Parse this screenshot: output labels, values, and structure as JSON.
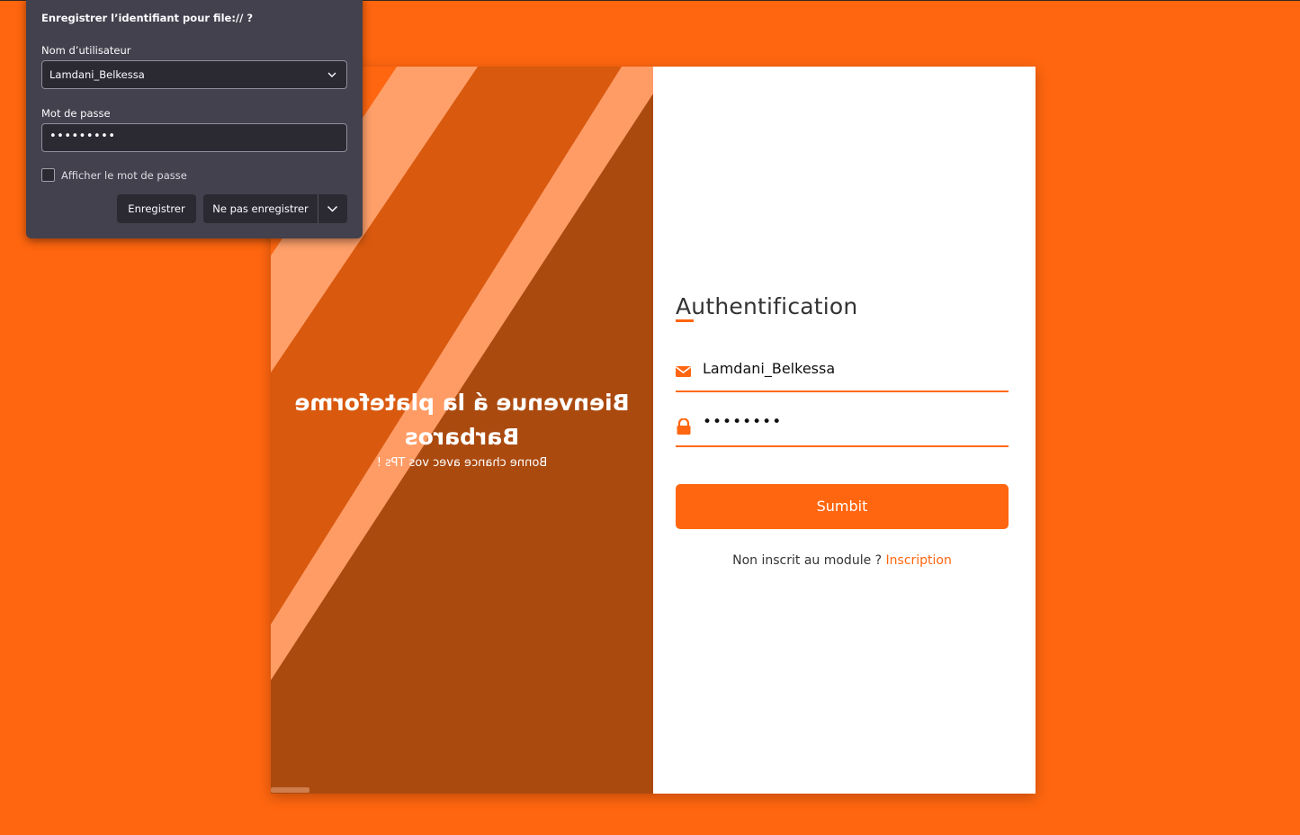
{
  "page": {
    "background": "#ff660f",
    "accent": "#ff660f"
  },
  "welcome": {
    "heading_line1": "Bienvenue á la plateforme",
    "heading_line2": "Barbaros",
    "subtitle": "Bonne chance avec vos TPs !"
  },
  "auth": {
    "title": "Authentification",
    "username_icon": "envelope-icon",
    "username_value": "Lamdani_Belkessa",
    "password_icon": "lock-icon",
    "password_value": "••••••••",
    "submit_label": "Sumbit",
    "signup_prompt": "Non inscrit au module ?",
    "signup_link": "Inscription"
  },
  "save_popup": {
    "title": "Enregistrer l’identifiant pour file:// ?",
    "username_label": "Nom d’utilisateur",
    "username_value": "Lamdani_Belkessa",
    "password_label": "Mot de passe",
    "password_value": "•••••••••",
    "show_password_label": "Afficher le mot de passe",
    "save_label": "Enregistrer",
    "dont_save_label": "Ne pas enregistrer"
  }
}
